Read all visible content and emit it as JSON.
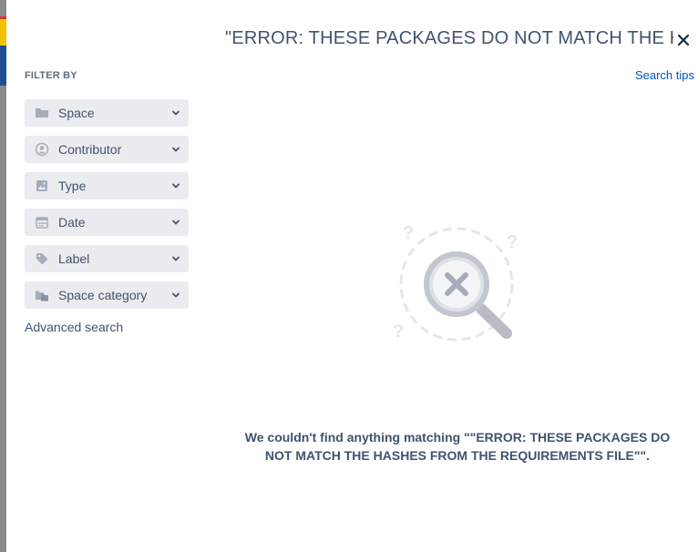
{
  "search": {
    "query_display": "\"ERROR: THESE PACKAGES DO NOT MATCH THE HASHES FROM THE REQUIREMENTS FILE\"",
    "close_icon": "close-icon"
  },
  "sidebar": {
    "heading": "FILTER BY",
    "filters": [
      {
        "label": "Space",
        "icon": "folder-icon"
      },
      {
        "label": "Contributor",
        "icon": "user-circle-icon"
      },
      {
        "label": "Type",
        "icon": "image-icon"
      },
      {
        "label": "Date",
        "icon": "calendar-icon"
      },
      {
        "label": "Label",
        "icon": "tag-icon"
      },
      {
        "label": "Space category",
        "icon": "folders-icon"
      }
    ],
    "advanced_link": "Advanced search"
  },
  "header": {
    "search_tips": "Search tips"
  },
  "empty_state": {
    "message": "We couldn't find anything matching \"\"ERROR: THESE PACKAGES DO NOT MATCH THE HASHES FROM THE REQUIREMENTS FILE\"\".",
    "illustration": "no-results-magnifier-icon"
  },
  "colors": {
    "accent_link": "#0052cc",
    "filter_bg": "#ebecf0",
    "text_muted": "#42526e"
  }
}
